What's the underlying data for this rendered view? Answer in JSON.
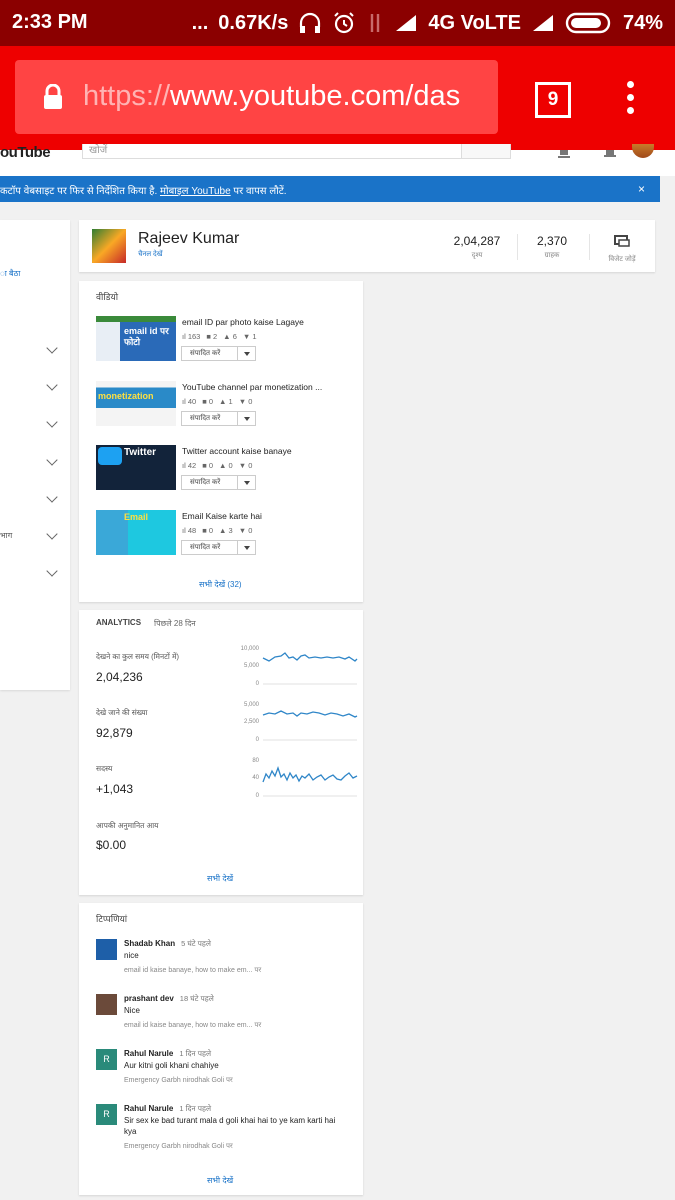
{
  "status": {
    "time": "2:33 PM",
    "dots": "...",
    "speed": "0.67K/s",
    "network": "4G VoLTE",
    "battery": "74%"
  },
  "browser": {
    "url_scheme": "https://",
    "url_rest": "www.youtube.com/das",
    "tab_count": "9"
  },
  "yt": {
    "logo_text": "ouTube",
    "search_placeholder": "खोजें"
  },
  "banner": {
    "text_before": "कटॉप वेबसाइट पर फिर से निर्देशित किया है.",
    "link": "मोबाइल YouTube",
    "text_after": "पर वापस लौटें.",
    "close": "×"
  },
  "left": {
    "link": "ा बैठा",
    "partial": "भाग"
  },
  "channel": {
    "name": "Rajeev Kumar",
    "view_channel": "चैनल देखें",
    "views_num": "2,04,287",
    "views_label": "दृश्य",
    "subs_num": "2,370",
    "subs_label": "ग्राहक",
    "widget_label": "विजेट जोड़ें"
  },
  "videos": {
    "title": "वीडियो",
    "edit_label": "संपादित करें",
    "see_all": "सभी देखें (32)",
    "items": [
      {
        "title": "email ID par photo kaise Lagaye",
        "views": "163",
        "comments": "2",
        "likes": "6",
        "dislikes": "1",
        "thumb_text": "email id पर फोटो"
      },
      {
        "title": "YouTube channel par monetization ...",
        "views": "40",
        "comments": "0",
        "likes": "1",
        "dislikes": "0",
        "thumb_text": "monetization"
      },
      {
        "title": "Twitter account kaise banaye",
        "views": "42",
        "comments": "0",
        "likes": "0",
        "dislikes": "0",
        "thumb_text": "Twitter"
      },
      {
        "title": "Email Kaise karte hai",
        "views": "48",
        "comments": "0",
        "likes": "3",
        "dislikes": "0",
        "thumb_text": "Email"
      }
    ]
  },
  "analytics": {
    "title": "ANALYTICS",
    "period": "पिछले 28 दिन",
    "watch_label": "देखने का कुल समय (मिनटों में)",
    "watch_value": "2,04,236",
    "watch_ticks": [
      "10,000",
      "5,000",
      "0"
    ],
    "views_label": "देखे जाने की संख्या",
    "views_value": "92,879",
    "views_ticks": [
      "5,000",
      "2,500",
      "0"
    ],
    "subs_label": "सदस्य",
    "subs_value": "+1,043",
    "subs_ticks": [
      "80",
      "40",
      "0"
    ],
    "revenue_label": "आपकी अनुमानित आय",
    "revenue_value": "$0.00",
    "see_all": "सभी देखें"
  },
  "comments": {
    "title": "टिप्पणियां",
    "on_word": "पर",
    "see_all": "सभी देखें",
    "items": [
      {
        "initial": "",
        "name": "Shadab Khan",
        "time": "5 घंटे पहले",
        "text": "nice",
        "video": "email id kaise banaye, how to make em...",
        "color": "#1e5fa8"
      },
      {
        "initial": "",
        "name": "prashant dev",
        "time": "18 घंटे पहले",
        "text": "Nice",
        "video": "email id kaise banaye, how to make em...",
        "color": "#6b4a3a"
      },
      {
        "initial": "R",
        "name": "Rahul Narule",
        "time": "1 दिन पहले",
        "text": "Aur kitni goli khani chahiye",
        "video": "Emergency Garbh nirodhak Goli",
        "color": "#2a8a7a"
      },
      {
        "initial": "R",
        "name": "Rahul Narule",
        "time": "1 दिन पहले",
        "text": "Sir sex ke bad turant mala d goli khai hai to ye kam karti hai kya",
        "video": "Emergency Garbh nirodhak Goli",
        "color": "#2a8a7a"
      }
    ]
  },
  "colors": {
    "chrome_red": "#ee0000",
    "status_red": "#8b0000",
    "link_blue": "#1a73c8",
    "spark_blue": "#2f86c8"
  }
}
